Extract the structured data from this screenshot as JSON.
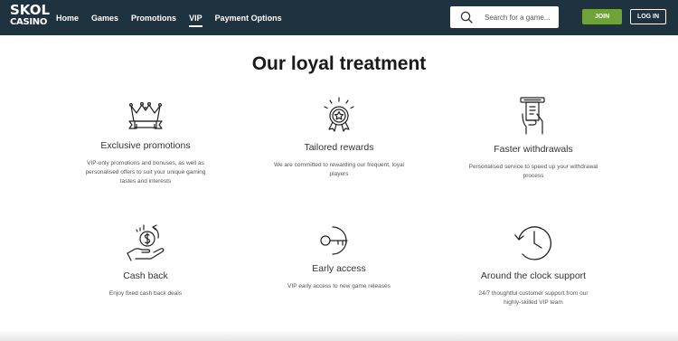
{
  "logo": {
    "line1": "SKOL",
    "line2": "CASINO"
  },
  "nav": {
    "items": [
      "Home",
      "Games",
      "Promotions",
      "VIP",
      "Payment Options"
    ],
    "active": "VIP"
  },
  "search": {
    "placeholder": "Search for a game...",
    "icon": "search-icon"
  },
  "auth": {
    "join_label": "JOIN",
    "login_label": "LOG IN"
  },
  "colors": {
    "topbar": "#1e323f",
    "join": "#6fa33a"
  },
  "page": {
    "heading": "Our loyal treatment"
  },
  "features": [
    {
      "icon": "crown-icon",
      "title": "Exclusive promotions",
      "description": "VIP-only promotions and bonuses, as well as personalised offers to suit your unique gaming tastes and interests"
    },
    {
      "icon": "award-medal-icon",
      "title": "Tailored rewards",
      "description": "We are committed to rewarding our frequent, loyal players"
    },
    {
      "icon": "atm-withdrawal-icon",
      "title": "Faster withdrawals",
      "description": "Personalised service to speed up your withdrawal process"
    },
    {
      "icon": "cash-back-hand-icon",
      "title": "Cash back",
      "description": "Enjoy fixed cash back deals"
    },
    {
      "icon": "key-icon",
      "title": "Early access",
      "description": "VIP early access to new game releases"
    },
    {
      "icon": "clock-icon",
      "title": "Around the clock support",
      "description": "24/7 thoughtful customer support from our highly-skilled VIP team"
    }
  ]
}
